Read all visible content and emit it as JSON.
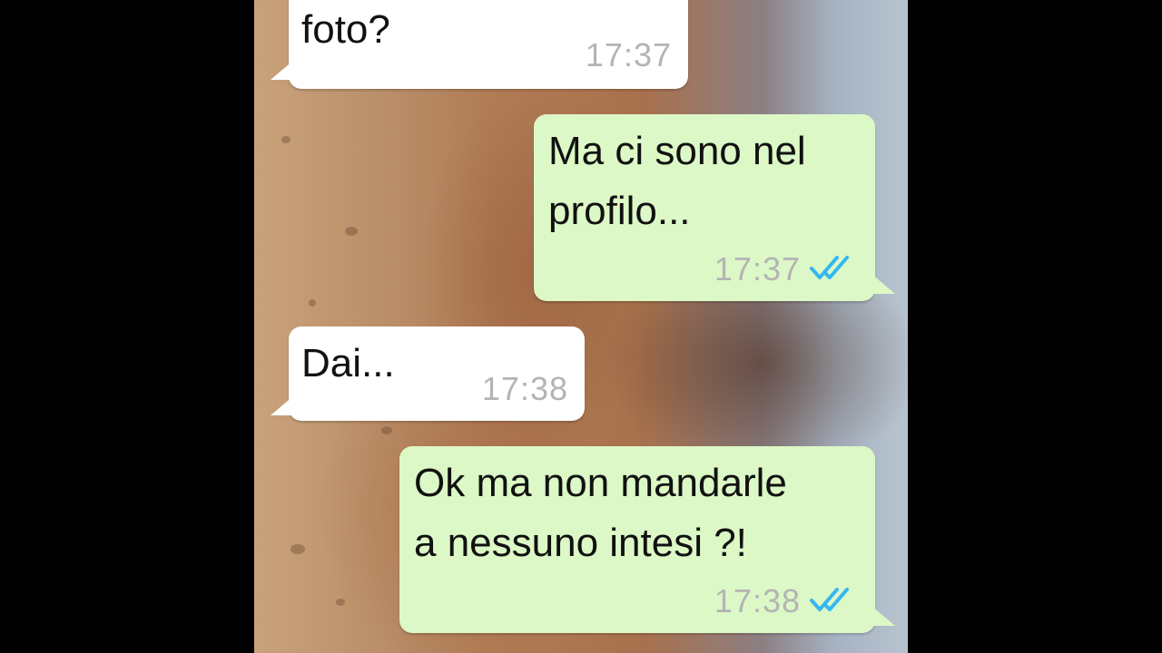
{
  "conversation": {
    "messages": [
      {
        "direction": "incoming",
        "text": "foto?",
        "time": "17:37"
      },
      {
        "direction": "outgoing",
        "line1": "Ma ci sono nel",
        "line2": "profilo...",
        "time": "17:37",
        "status": "read"
      },
      {
        "direction": "incoming",
        "text": "Dai...",
        "time": "17:38"
      },
      {
        "direction": "outgoing",
        "line1": "Ok ma non mandarle",
        "line2": "a nessuno intesi ?!",
        "time": "17:38",
        "status": "read"
      }
    ]
  },
  "colors": {
    "outgoing_bubble": "#dcf8c6",
    "incoming_bubble": "#ffffff",
    "timestamp": "#b4b4b4",
    "read_ticks": "#34b7f1",
    "frame": "#000000"
  },
  "icons": {
    "read_receipt": "double-check-icon"
  }
}
